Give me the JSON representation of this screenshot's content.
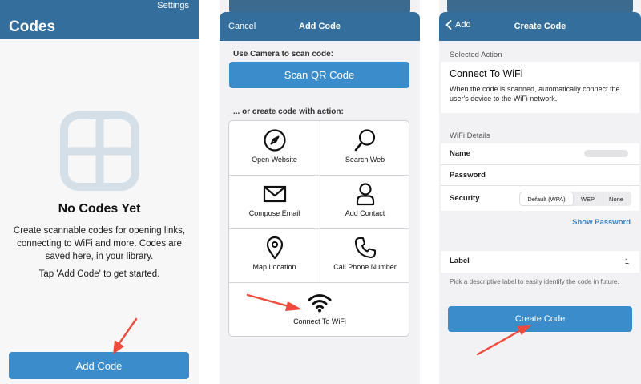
{
  "colors": {
    "header": "#336e9c",
    "button": "#3b8ccb",
    "link": "#3b82c4",
    "annotation_arrow": "#ef4b3c"
  },
  "panel_codes": {
    "settings_label": "Settings",
    "title": "Codes",
    "empty_icon": "grid-icon",
    "empty_title": "No Codes Yet",
    "description": "Create scannable codes for opening links, connecting to WiFi and more. Codes are saved here, in your library.",
    "hint": "Tap 'Add Code' to get started.",
    "add_button_label": "Add Code"
  },
  "panel_add_code": {
    "cancel_label": "Cancel",
    "title": "Add Code",
    "camera_label": "Use Camera to scan code:",
    "scan_button_label": "Scan QR Code",
    "or_label": "... or create code with action:",
    "actions": [
      {
        "label": "Open Website",
        "icon": "compass-icon"
      },
      {
        "label": "Search Web",
        "icon": "magnifier-icon"
      },
      {
        "label": "Compose Email",
        "icon": "envelope-icon"
      },
      {
        "label": "Add Contact",
        "icon": "person-icon"
      },
      {
        "label": "Map Location",
        "icon": "map-pin-icon"
      },
      {
        "label": "Call Phone Number",
        "icon": "phone-icon"
      },
      {
        "label": "Connect To WiFi",
        "icon": "wifi-icon"
      }
    ]
  },
  "panel_create_code": {
    "back_label": "Add",
    "title": "Create Code",
    "selected_action_section": "Selected Action",
    "action_title": "Connect To WiFi",
    "action_description": "When the code is scanned, automatically connect the user's device to the WiFi network.",
    "wifi_section": "WiFi Details",
    "name_label": "Name",
    "password_label": "Password",
    "security_label": "Security",
    "security_options": [
      "Default (WPA)",
      "WEP",
      "None"
    ],
    "security_selected": "Default (WPA)",
    "show_password_label": "Show Password",
    "label_label": "Label",
    "label_value": "1",
    "label_hint": "Pick a descriptive label to easily identify the code in future.",
    "create_button_label": "Create Code"
  }
}
